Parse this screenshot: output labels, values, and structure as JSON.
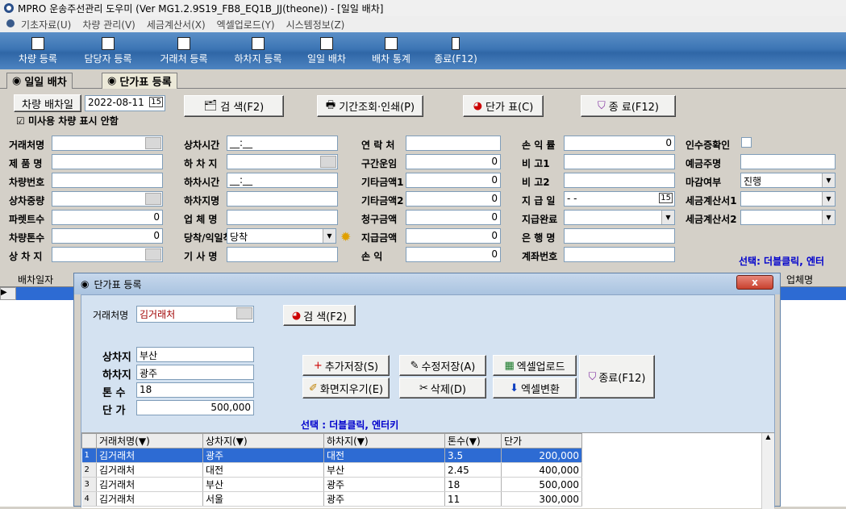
{
  "window": {
    "title": "MPRO 운송주선관리 도우미 (Ver MG1.2.9S19_FB8_EQ1B_JJ(theone)) - [일일 배차]"
  },
  "menu": [
    "기초자료(U)",
    "차량 관리(V)",
    "세금계산서(X)",
    "엑셀업로드(Y)",
    "시스템정보(Z)"
  ],
  "toolbar": [
    "차량 등록",
    "담당자 등록",
    "거래처 등록",
    "하차지 등록",
    "일일 배차",
    "배차 통계",
    "종료(F12)"
  ],
  "tabs": [
    "일일 배차",
    "단가표 등록"
  ],
  "top": {
    "car_dispatch_btn": "차량 배차일",
    "date": "2022-08-11",
    "search_btn": "검 색(F2)",
    "period_btn": "기간조회·인쇄(P)",
    "price_btn": "단가 표(C)",
    "exit_btn": "종  료(F12)",
    "unused_checkbox": "미사용 차량 표시 안함"
  },
  "form": {
    "c1": [
      "거래처명",
      "제 품 명",
      "차량번호",
      "상차중량",
      "파렛트수",
      "차량톤수",
      "상 차 지"
    ],
    "c1_vals": [
      "",
      "",
      "",
      "",
      "0",
      "0",
      ""
    ],
    "c2": [
      "상차시간",
      "하 차 지",
      "하차시간",
      "하차지명",
      "업 체 명",
      "당착/익일착",
      "기 사 명"
    ],
    "c2_vals": [
      "__:__",
      "",
      "__:__",
      "",
      "",
      "당착",
      ""
    ],
    "c3": [
      "연 락 처",
      "구간운임",
      "기타금액1",
      "기타금액2",
      "청구금액",
      "지급금액",
      "손   익"
    ],
    "c3_vals": [
      "",
      "0",
      "0",
      "0",
      "0",
      "0",
      "0"
    ],
    "c4": [
      "손 익 률",
      "비  고1",
      "비  고2",
      "지 급 일",
      "지급완료",
      "은 행 명",
      "계좌번호"
    ],
    "c4_vals": [
      "0",
      "",
      "",
      "  -  -",
      "",
      "",
      ""
    ],
    "c5": [
      "인수증확인",
      "예금주명",
      "마감여부",
      "세금계산서1",
      "세금계산서2"
    ],
    "c5_vals": [
      "",
      "",
      "진행",
      "",
      ""
    ],
    "hint": "선택: 더블클릭, 엔터"
  },
  "bg_grid": {
    "col1": "배차일자",
    "col_last": "업체명"
  },
  "dialog": {
    "title": "단가표 등록",
    "close": "x",
    "client_label": "거래처명",
    "client_value": "김거래처",
    "search_btn": "검 색(F2)",
    "fields": [
      {
        "label": "상차지",
        "value": "부산"
      },
      {
        "label": "하차지",
        "value": "광주"
      },
      {
        "label": "톤  수",
        "value": "18"
      },
      {
        "label": "단  가",
        "value": "500,000"
      }
    ],
    "buttons": {
      "add_save": "추가저장(S)",
      "edit_save": "수정저장(A)",
      "excel_upload": "엑셀업로드",
      "exit": "종료(F12)",
      "clear": "화면지우기(E)",
      "delete": "삭제(D)",
      "excel_convert": "엑셀변환"
    },
    "hint": "선택 : 더블클릭, 엔터키",
    "headers": [
      "거래처명(▼)",
      "상차지(▼)",
      "하차지(▼)",
      "톤수(▼)",
      "단가"
    ],
    "rows": [
      [
        "1",
        "김거래처",
        "광주",
        "대전",
        "3.5",
        "200,000"
      ],
      [
        "2",
        "김거래처",
        "대전",
        "부산",
        "2.45",
        "400,000"
      ],
      [
        "3",
        "김거래처",
        "부산",
        "광주",
        "18",
        "500,000"
      ],
      [
        "4",
        "김거래처",
        "서울",
        "광주",
        "11",
        "300,000"
      ]
    ]
  }
}
